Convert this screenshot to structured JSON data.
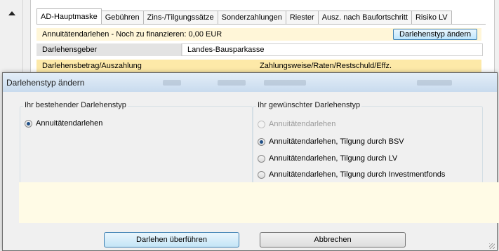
{
  "background": {
    "tabs": [
      "AD-Hauptmaske",
      "Gebühren",
      "Zins-/Tilgungssätze",
      "Sonderzahlungen",
      "Riester",
      "Ausz. nach Baufortschritt",
      "Risiko LV"
    ],
    "row1_text": "Annuitätendarlehen - Noch zu finanzieren: 0,00 EUR",
    "change_type_button": "Darlehenstyp ändern",
    "lender_label": "Darlehensgeber",
    "lender_value": "Landes-Bausparkasse",
    "amount_label": "Darlehensbetrag/Auszahlung",
    "payment_label": "Zahlungsweise/Raten/Restschuld/Effz."
  },
  "dialog": {
    "title": "Darlehenstyp ändern",
    "existing_group_label": "Ihr bestehender Darlehenstyp",
    "existing_options": [
      {
        "label": "Annuitätendarlehen",
        "checked": true,
        "disabled": false
      }
    ],
    "desired_group_label": "Ihr gewünschter Darlehenstyp",
    "desired_options": [
      {
        "label": "Annuitätendarlehen",
        "checked": false,
        "disabled": true
      },
      {
        "label": "Annuitätendarlehen, Tilgung durch BSV",
        "checked": true,
        "disabled": false
      },
      {
        "label": "Annuitätendarlehen, Tilgung durch LV",
        "checked": false,
        "disabled": false
      },
      {
        "label": "Annuitätendarlehen, Tilgung durch Investmentfonds",
        "checked": false,
        "disabled": false
      }
    ],
    "transfer_button": "Darlehen überführen",
    "cancel_button": "Abbrechen"
  }
}
